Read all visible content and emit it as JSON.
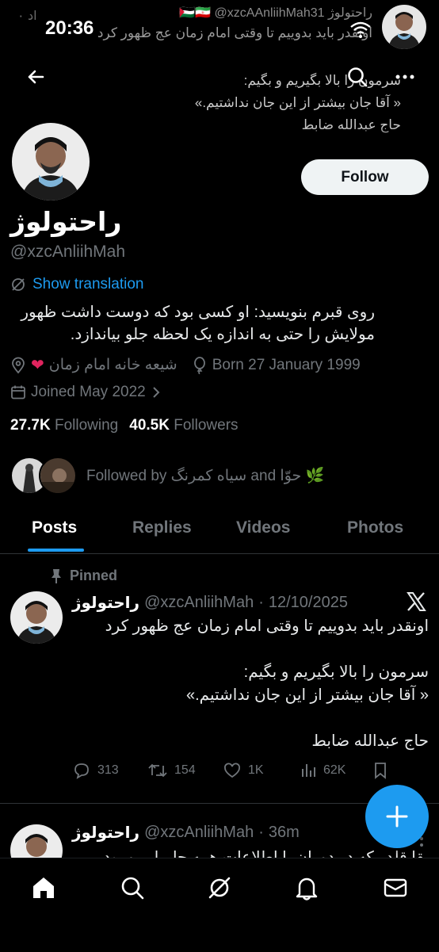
{
  "status_bar": {
    "time": "20:36",
    "notification": {
      "handle_fragment": "۰ اد",
      "title": "راحتولوژ 🇵🇸🇮🇷 @xzcAAnliihMah31",
      "body": "اونقدر باید بدوییم تا وقتی امام زمان عج ظهور کرد"
    }
  },
  "top_bar": {
    "header_line1": "سرمون را بالا بگیریم و بگیم:",
    "header_line2": "« آقا جان بیشتر از این جان نداشتیم.»",
    "header_line3": "حاج عبدالله ضابط"
  },
  "profile": {
    "display_name": "راحتولوژ",
    "handle": "@xzcAnliihMah",
    "follow_label": "Follow",
    "translate_label": "Show translation",
    "bio": "روی قبرم بنویسید: او کسی بود که دوست داشت ظهور مولایش را حتی به اندازه یک لحظه جلو بیاندازد.",
    "location": "شیعه خانه امام زمان",
    "born": "Born 27 January 1999",
    "joined": "Joined May 2022",
    "following_count": "27.7K",
    "following_label": "Following",
    "followers_count": "40.5K",
    "followers_label": "Followers",
    "followed_by_text": "Followed by سیاه کمرنگ and حوّا 🌿"
  },
  "tabs": [
    {
      "label": "Posts",
      "active": true
    },
    {
      "label": "Replies",
      "active": false
    },
    {
      "label": "Videos",
      "active": false
    },
    {
      "label": "Photos",
      "active": false
    }
  ],
  "tweets": [
    {
      "pinned_label": "Pinned",
      "name": "راحتولوژ",
      "handle": "@xzcAnliihMah",
      "date": "12/10/2025",
      "body": [
        "اونقدر باید بدوییم تا وقتی امام زمان عج ظهور کرد",
        "",
        "سرمون را بالا بگیریم و بگیم:",
        "« آقا جان بیشتر از این جان نداشتیم.»",
        "",
        "حاج عبدالله ضابط"
      ],
      "replies": "313",
      "reposts": "154",
      "likes": "1K",
      "views": "62K"
    },
    {
      "name": "راحتولوژ",
      "handle": "@xzcAnliihMah",
      "date": "36m",
      "body": "بقا قلدر که در دوران با اطلاعات همه جا بیایم و بود"
    }
  ],
  "colors": {
    "accent": "#1d9bf0",
    "background": "#000000",
    "muted": "#71767b",
    "text": "#e7e9ea"
  },
  "icons": {
    "back": "arrow-left-icon",
    "search": "search-icon",
    "more": "more-horizontal-icon",
    "translate": "translate-icon",
    "location": "location-pin-icon",
    "born": "balloon-icon",
    "joined": "calendar-icon",
    "pinned": "pin-icon",
    "x_logo": "x-logo-icon",
    "compose": "plus-icon",
    "nav": [
      "home-icon",
      "search-icon",
      "grok-icon",
      "bell-icon",
      "mail-icon"
    ]
  }
}
